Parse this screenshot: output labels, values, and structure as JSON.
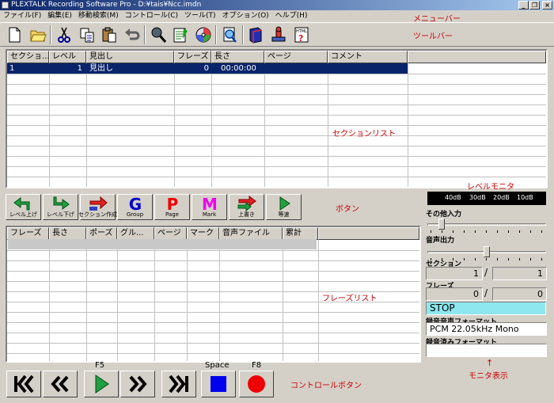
{
  "window": {
    "title": "PLEXTALK Recording Software Pro - D:¥tais¥Ncc.imdn",
    "minimize": "_",
    "restore": "❐",
    "close": "×"
  },
  "menu": [
    "ファイル(F)",
    "編集(E)",
    "移動検索(M)",
    "コントロール(C)",
    "ツール(T)",
    "オプション(O)",
    "ヘルプ(H)"
  ],
  "annotations": {
    "menubar": "メニューバー",
    "toolbar": "ツールバー",
    "section_list": "セクションリスト",
    "level_monitor": "レベルモニタ",
    "buttons": "ボタン",
    "phrase_list": "フレーズリスト",
    "control_buttons": "コントロールボタン",
    "monitor_display": "モニタ表示",
    "arrow": "↑"
  },
  "toolbar_icons": [
    "new-file-icon",
    "open-folder-icon",
    "cut-icon",
    "copy-icon",
    "paste-icon",
    "undo-icon",
    "microphone-icon",
    "book-edit-icon",
    "disc-icon",
    "search-doc-icon",
    "book-icon",
    "stamp-icon",
    "html-help-icon"
  ],
  "section_list": {
    "columns": [
      "セクショ...",
      "レベル",
      "見出し",
      "フレーズ",
      "長さ",
      "ページ",
      "コメント"
    ],
    "rows": [
      {
        "section": "1",
        "level": "1",
        "heading": "見出し",
        "phrases": "0",
        "length": "00:00:00",
        "page": "",
        "comment": ""
      }
    ]
  },
  "buttons": [
    {
      "label": "レベル上げ",
      "icon": "level-up-icon"
    },
    {
      "label": "レベル下げ",
      "icon": "level-down-icon"
    },
    {
      "label": "セクション作成",
      "icon": "create-section-icon"
    },
    {
      "label": "Group",
      "glyph": "G",
      "color": "#0000cc"
    },
    {
      "label": "Page",
      "glyph": "P",
      "color": "#ee0000"
    },
    {
      "label": "Mark",
      "glyph": "M",
      "color": "#ee00ee"
    },
    {
      "label": "上書き",
      "icon": "overwrite-icon"
    },
    {
      "label": "等速",
      "icon": "normal-speed-icon"
    }
  ],
  "phrase_list": {
    "columns": [
      "フレーズ",
      "長さ",
      "ポーズ",
      "グル...",
      "ページ",
      "マーク",
      "音声ファイル",
      "累計"
    ]
  },
  "controls": {
    "keys": {
      "play": "F5",
      "stop": "Space",
      "record": "F8"
    },
    "buttons": [
      "skip-to-start-icon",
      "rewind-icon",
      "play-icon",
      "fast-forward-icon",
      "skip-to-end-icon",
      "stop-icon",
      "record-icon"
    ]
  },
  "monitor": {
    "meter_labels": [
      "40dB",
      "30dB",
      "20dB",
      "10dB"
    ],
    "other_input_label": "その他入力",
    "audio_output_label": "音声出力",
    "other_input_level": 0.1,
    "audio_output_level": 0.5,
    "section_label": "セクション",
    "section_current": "1",
    "section_total": "1",
    "phrase_label": "フレーズ",
    "phrase_current": "0",
    "phrase_total": "0",
    "slash": "/",
    "status": "STOP",
    "record_format_label": "録音音声フォーマット",
    "record_format": "PCM 22.05kHz Mono",
    "recorded_format_label": "録音済みフォーマット",
    "recorded_format": ""
  }
}
